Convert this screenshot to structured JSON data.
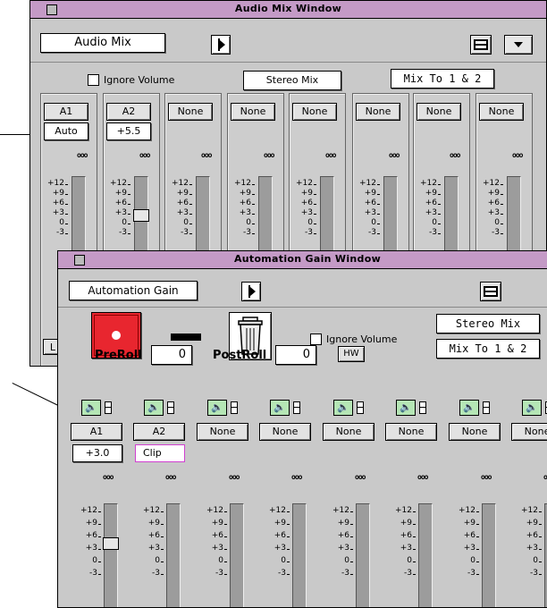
{
  "mix_window": {
    "title": "Audio Mix Window",
    "name_field": "Audio Mix",
    "ignore_volume_label": "Ignore Volume",
    "stereo_mix_label": "Stereo Mix",
    "mix_to_label": "Mix To 1 & 2",
    "bottom_left_label": "L",
    "channels": [
      {
        "track": "A1",
        "value": "Auto",
        "fader_level": null
      },
      {
        "track": "A2",
        "value": "+5.5",
        "fader_level": 0.45
      },
      {
        "track": "None"
      },
      {
        "track": "None"
      },
      {
        "track": "None"
      },
      {
        "track": "None"
      },
      {
        "track": "None"
      },
      {
        "track": "None"
      }
    ],
    "scale_labels": [
      "+12",
      "+9",
      "+6",
      "+3",
      "0",
      "-3"
    ]
  },
  "gain_window": {
    "title": "Automation Gain Window",
    "name_field": "Automation Gain",
    "ignore_volume_label": "Ignore Volume",
    "stereo_mix_label": "Stereo Mix",
    "mix_to_label": "Mix To 1 & 2",
    "preroll_label": "PreRoll",
    "preroll_value": "0",
    "postroll_label": "PostRoll",
    "postroll_value": "0",
    "hw_label": "HW",
    "record_button_color": "#e8262f",
    "channels": [
      {
        "track": "A1",
        "value": "+3.0",
        "fader_level": 0.35
      },
      {
        "track": "A2",
        "value": "Clip"
      },
      {
        "track": "None"
      },
      {
        "track": "None"
      },
      {
        "track": "None"
      },
      {
        "track": "None"
      },
      {
        "track": "None"
      },
      {
        "track": "None"
      }
    ],
    "scale_labels": [
      "+12",
      "+9",
      "+6",
      "+3",
      "0",
      "-3"
    ]
  }
}
